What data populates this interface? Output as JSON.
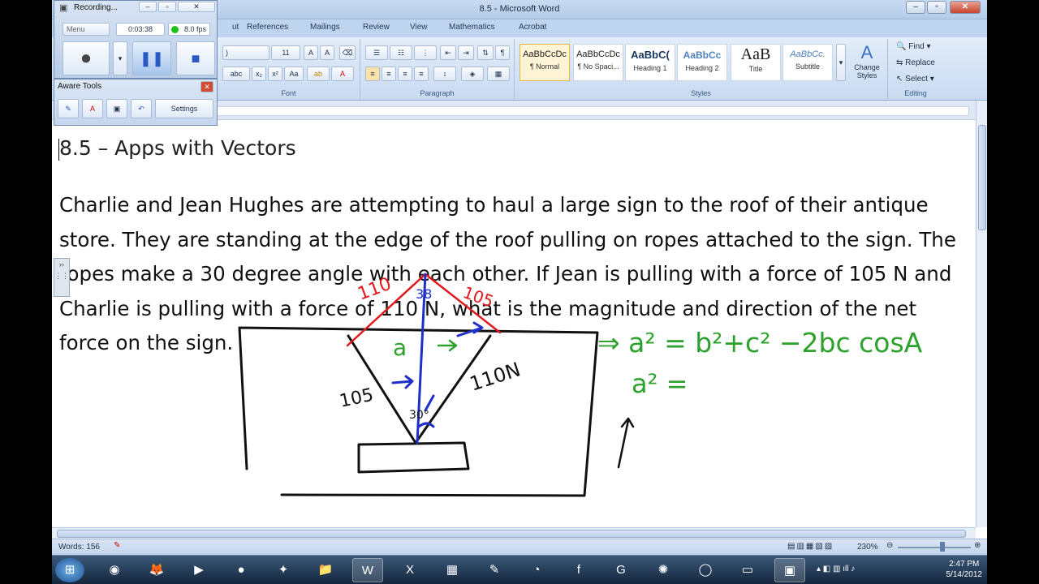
{
  "window": {
    "title": "8.5 - Microsoft Word"
  },
  "ribbon": {
    "tabs": [
      "ut",
      "References",
      "Mailings",
      "Review",
      "View",
      "Mathematics",
      "Acrobat"
    ],
    "font": {
      "name": ")",
      "size": "11",
      "group_label": "Font"
    },
    "paragraph": {
      "group_label": "Paragraph"
    },
    "styles": {
      "group_label": "Styles",
      "items": [
        {
          "preview": "AaBbCcDc",
          "name": "¶ Normal"
        },
        {
          "preview": "AaBbCcDc",
          "name": "¶ No Spaci..."
        },
        {
          "preview": "AaBbC(",
          "name": "Heading 1"
        },
        {
          "preview": "AaBbCc",
          "name": "Heading 2"
        },
        {
          "preview": "AaB",
          "name": "Title"
        },
        {
          "preview": "AaBbCc.",
          "name": "Subtitle"
        }
      ],
      "change_styles": "Change Styles"
    },
    "editing": {
      "group_label": "Editing",
      "find": "Find",
      "replace": "Replace",
      "select": "Select"
    }
  },
  "recorder": {
    "title": "Recording...",
    "menu": "Menu",
    "time": "0:03:38",
    "fps": "8.0 fps"
  },
  "aware_tools": {
    "title": "Aware Tools",
    "settings": "Settings"
  },
  "document": {
    "heading": "8.5 – Apps with Vectors",
    "paragraph": "Charlie and Jean Hughes are attempting to haul a large sign to the roof of their antique store. They are standing at the edge of the roof pulling on ropes attached to the sign. The ropes make a 30 degree angle with each other. If Jean is pulling with a force of 105 N and Charlie is pulling with a force of 110 N, what is the magnitude and direction of the net force on the sign."
  },
  "annotations": {
    "label_110": "110",
    "label_105_red": "105",
    "label_38": "38",
    "label_a": "a",
    "label_105_black": "105",
    "label_110N": "110N",
    "label_30": "30°",
    "formula": "⇒ a² = b²+c² −2bc cosA",
    "formula2": "a² =",
    "colors": {
      "red": "#e0191f",
      "blue": "#1f2fc8",
      "green": "#2ca12c",
      "black": "#111111"
    }
  },
  "status": {
    "words": "Words: 156",
    "zoom": "230%"
  },
  "taskbar": {
    "time": "2:47 PM",
    "date": "5/14/2012"
  }
}
